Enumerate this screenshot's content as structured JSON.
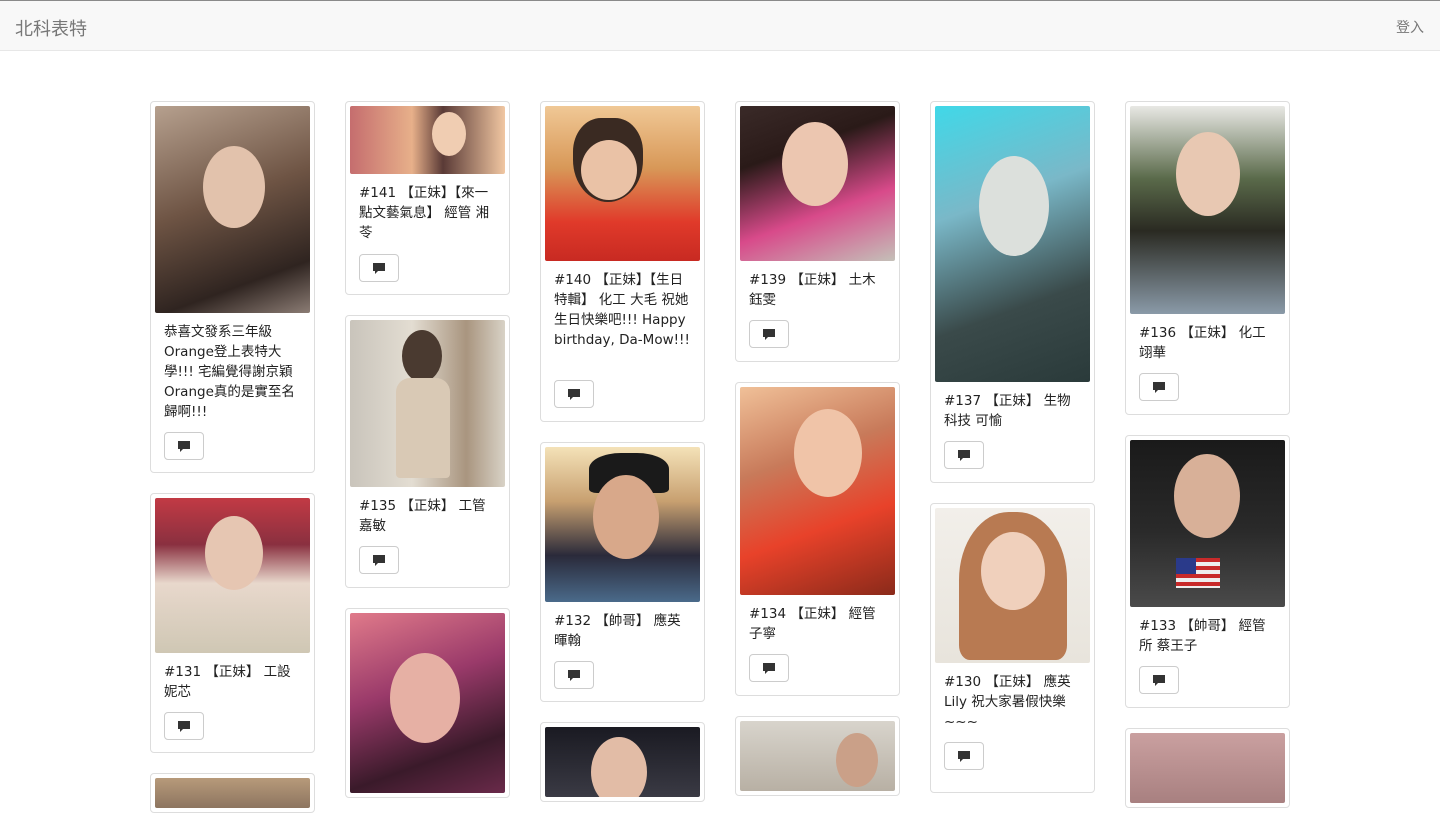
{
  "navbar": {
    "brand": "北科表特",
    "login": "登入"
  },
  "posts": [
    {
      "caption": "恭喜文發系三年級Orange登上表特大學!!! 宅編覺得謝京穎Orange真的是實至名歸啊!!!",
      "photo": "woman-selfie-long-hair"
    },
    {
      "caption": "#141 【正妹】【來一點文藝氣息】 經管 湘苓",
      "photo": "woman-portrait-warm"
    },
    {
      "caption": "#140 【正妹】【生日特輯】 化工 大毛 祝她生日快樂吧!!! Happy birthday, Da-Mow!!!",
      "photo": "woman-glasses-phone"
    },
    {
      "caption": "#139 【正妹】 土木 鈺雯",
      "photo": "woman-selfie"
    },
    {
      "caption": "#137 【正妹】 生物科技 可愉",
      "photo": "woman-selfie-teal"
    },
    {
      "caption": "#136 【正妹】 化工 翊華",
      "photo": "woman-outdoor"
    },
    {
      "caption": "#131 【正妹】 工設 妮芯",
      "photo": "woman-smiling-train"
    },
    {
      "caption": "#135 【正妹】 工管 嘉敏",
      "photo": "woman-sweater-outdoor"
    },
    {
      "caption": "#132 【帥哥】 應英 暉翰",
      "photo": "man-selfie"
    },
    {
      "caption": "#134 【正妹】 經管 子寧",
      "photo": "woman-red-hoodie"
    },
    {
      "caption": "#130 【正妹】 應英 Lily 祝大家暑假快樂~~~",
      "photo": "woman-long-hair-smile"
    },
    {
      "caption": "#133 【帥哥】 經管所 蔡王子",
      "photo": "man-flag-sweater"
    },
    {
      "caption": "",
      "photo": "photo-partial"
    },
    {
      "caption": "",
      "photo": "woman-pink-portrait"
    },
    {
      "caption": "",
      "photo": "woman-partial"
    },
    {
      "caption": "",
      "photo": "man-partial"
    },
    {
      "caption": "",
      "photo": "photo-partial"
    }
  ],
  "comment_icon": "comment-icon"
}
